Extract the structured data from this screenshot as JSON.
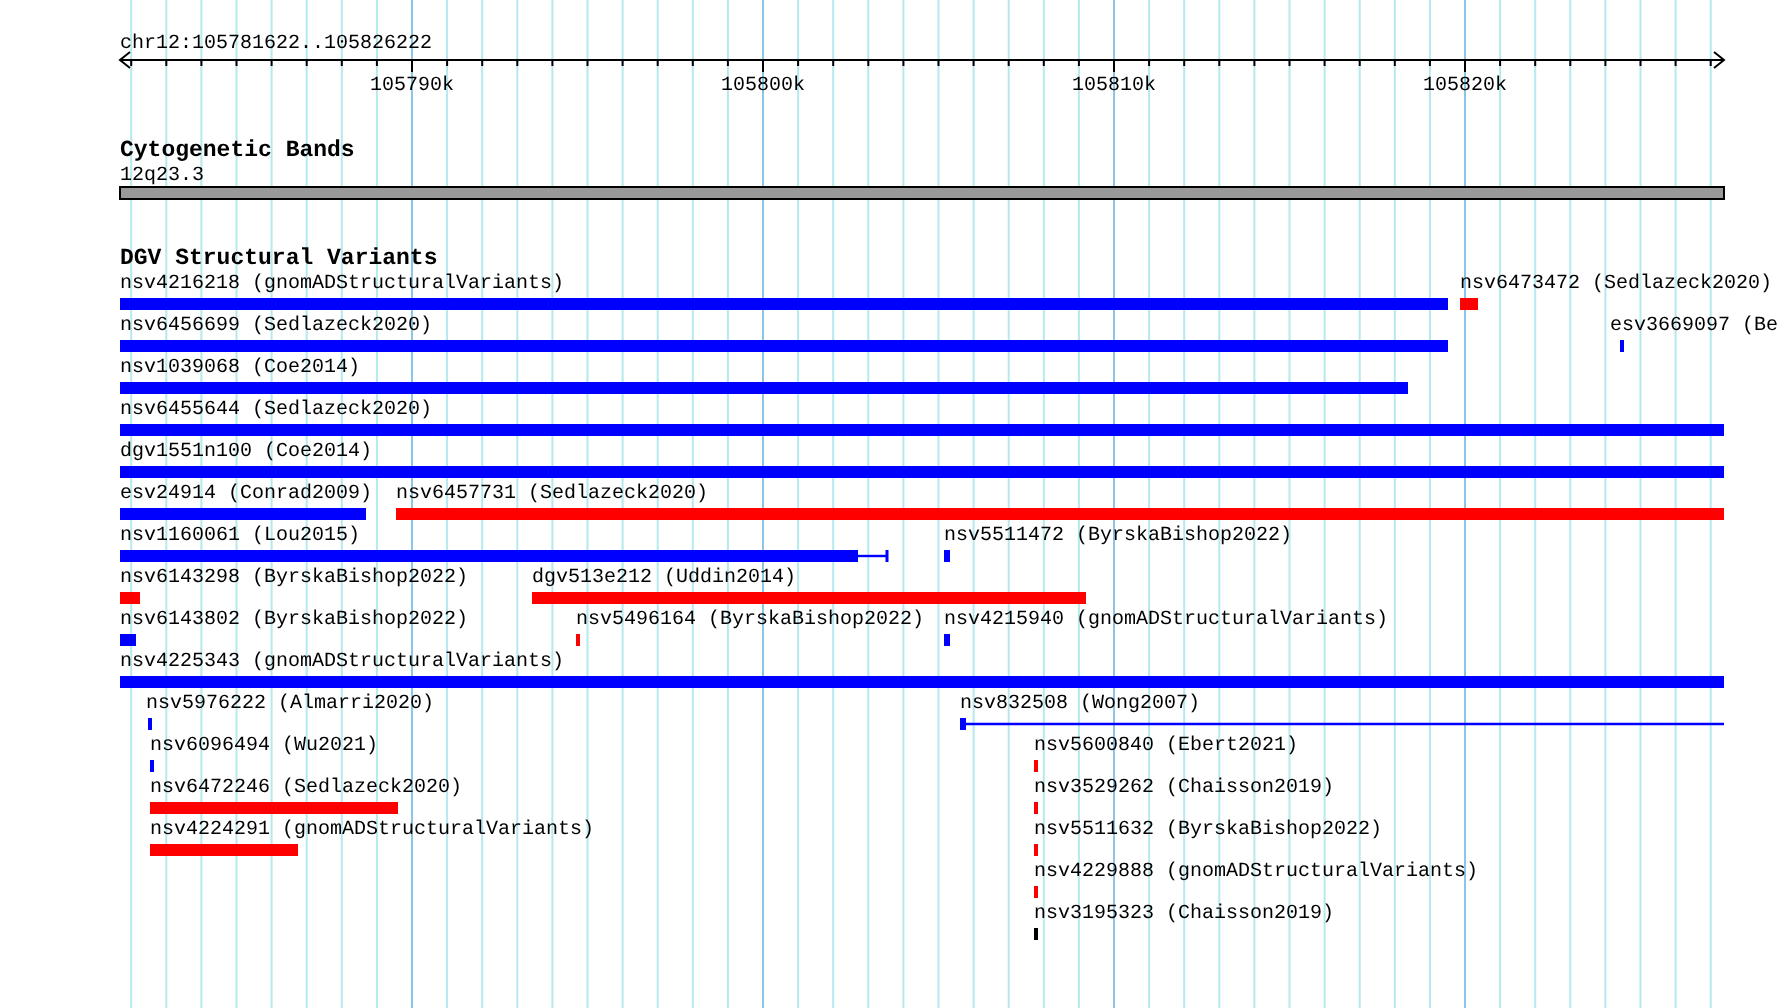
{
  "ruler": {
    "location": "chr12:105781622..105826222",
    "ticks": [
      "105790k",
      "105800k",
      "105810k",
      "105820k"
    ]
  },
  "tracks": [
    {
      "title": "Cytogenetic Bands",
      "kind": "bands",
      "band_label": "12q23.3"
    },
    {
      "title": "DGV Structural Variants",
      "kind": "features",
      "features": [
        {
          "label": "nsv4216218 (gnomADStructuralVariants)",
          "color": "#0000ff",
          "kind": "block"
        },
        {
          "label": "nsv6473472 (Sedlazeck2020)",
          "color": "#ff0000",
          "kind": "block"
        },
        {
          "label": "nsv6456699 (Sedlazeck2020)",
          "color": "#0000ff",
          "kind": "block"
        },
        {
          "label": "esv3669097 (Be",
          "color": "#0000ff",
          "kind": "block"
        },
        {
          "label": "nsv1039068 (Coe2014)",
          "color": "#0000ff",
          "kind": "block"
        },
        {
          "label": "nsv6455644 (Sedlazeck2020)",
          "color": "#0000ff",
          "kind": "block"
        },
        {
          "label": "dgv1551n100 (Coe2014)",
          "color": "#0000ff",
          "kind": "block"
        },
        {
          "label": "esv24914 (Conrad2009)",
          "color": "#0000ff",
          "kind": "block"
        },
        {
          "label": "nsv6457731 (Sedlazeck2020)",
          "color": "#ff0000",
          "kind": "block"
        },
        {
          "label": "nsv1160061 (Lou2015)",
          "color": "#0000ff",
          "kind": "gapped"
        },
        {
          "label": "nsv5511472 (ByrskaBishop2022)",
          "color": "#0000ff",
          "kind": "block"
        },
        {
          "label": "nsv6143298 (ByrskaBishop2022)",
          "color": "#ff0000",
          "kind": "block"
        },
        {
          "label": "dgv513e212 (Uddin2014)",
          "color": "#ff0000",
          "kind": "block"
        },
        {
          "label": "nsv6143802 (ByrskaBishop2022)",
          "color": "#0000ff",
          "kind": "block"
        },
        {
          "label": "nsv5496164 (ByrskaBishop2022)",
          "color": "#ff0000",
          "kind": "block"
        },
        {
          "label": "nsv4215940 (gnomADStructuralVariants)",
          "color": "#0000ff",
          "kind": "block"
        },
        {
          "label": "nsv4225343 (gnomADStructuralVariants)",
          "color": "#0000ff",
          "kind": "block"
        },
        {
          "label": "nsv5976222 (Almarri2020)",
          "color": "#0000ff",
          "kind": "block"
        },
        {
          "label": "nsv832508 (Wong2007)",
          "color": "#0000ff",
          "kind": "gapped"
        },
        {
          "label": "nsv6096494 (Wu2021)",
          "color": "#0000ff",
          "kind": "block"
        },
        {
          "label": "nsv5600840 (Ebert2021)",
          "color": "#ff0000",
          "kind": "block"
        },
        {
          "label": "nsv6472246 (Sedlazeck2020)",
          "color": "#ff0000",
          "kind": "block"
        },
        {
          "label": "nsv3529262 (Chaisson2019)",
          "color": "#ff0000",
          "kind": "block"
        },
        {
          "label": "nsv4224291 (gnomADStructuralVariants)",
          "color": "#ff0000",
          "kind": "block"
        },
        {
          "label": "nsv5511632 (ByrskaBishop2022)",
          "color": "#ff0000",
          "kind": "block"
        },
        {
          "label": "nsv4229888 (gnomADStructuralVariants)",
          "color": "#ff0000",
          "kind": "block"
        },
        {
          "label": "nsv3195323 (Chaisson2019)",
          "color": "#000000",
          "kind": "block"
        }
      ]
    }
  ]
}
